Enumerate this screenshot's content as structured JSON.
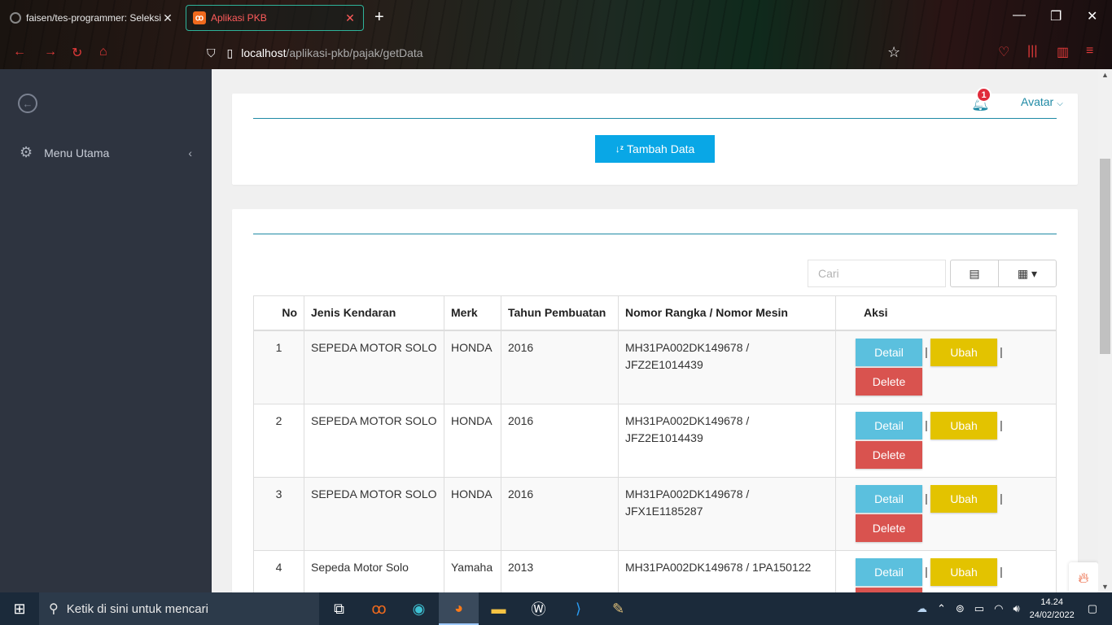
{
  "browser": {
    "tabs": [
      {
        "label": "faisen/tes-programmer: Seleksi",
        "active": false
      },
      {
        "label": "Aplikasi PKB",
        "active": true
      }
    ],
    "url_host": "localhost",
    "url_path": "/aplikasi-pkb/pajak/getData"
  },
  "sidebar": {
    "menu_label": "Menu Utama"
  },
  "header": {
    "notification_count": "1",
    "avatar_label": "Avatar"
  },
  "toolbar": {
    "add_label": "Tambah Data",
    "search_placeholder": "Cari"
  },
  "table": {
    "columns": [
      "No",
      "Jenis Kendaran",
      "Merk",
      "Tahun Pembuatan",
      "Nomor Rangka / Nomor Mesin",
      "Aksi"
    ],
    "rows": [
      {
        "no": "1",
        "jenis": "SEPEDA MOTOR SOLO",
        "merk": "HONDA",
        "tahun": "2016",
        "nomor": "MH31PA002DK149678 / JFZ2E1014439"
      },
      {
        "no": "2",
        "jenis": "SEPEDA MOTOR SOLO",
        "merk": "HONDA",
        "tahun": "2016",
        "nomor": "MH31PA002DK149678 / JFZ2E1014439"
      },
      {
        "no": "3",
        "jenis": "SEPEDA MOTOR SOLO",
        "merk": "HONDA",
        "tahun": "2016",
        "nomor": "MH31PA002DK149678 / JFX1E1185287"
      },
      {
        "no": "4",
        "jenis": "Sepeda Motor Solo",
        "merk": "Yamaha",
        "tahun": "2013",
        "nomor": "MH31PA002DK149678 / 1PA150122"
      }
    ],
    "actions": {
      "detail": "Detail",
      "ubah": "Ubah",
      "delete": "Delete",
      "separator": "|"
    }
  },
  "taskbar": {
    "search_placeholder": "Ketik di sini untuk mencari",
    "time": "14.24",
    "date": "24/02/2022"
  }
}
